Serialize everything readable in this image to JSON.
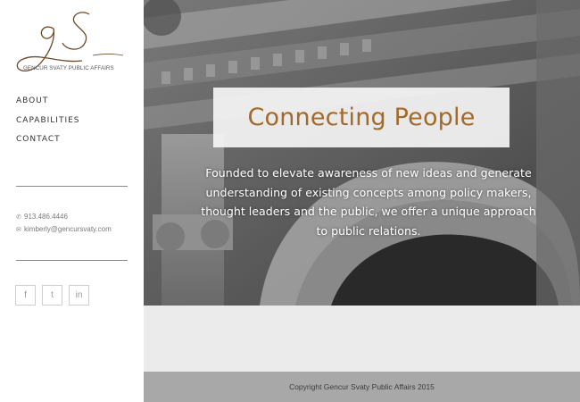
{
  "logo": {
    "monogram": "gS",
    "text": "GENCUR SVATY PUBLIC AFFAIRS",
    "icon": "gs-monogram-logo"
  },
  "nav": {
    "items": [
      {
        "label": "ABOUT"
      },
      {
        "label": "CAPABILITIES"
      },
      {
        "label": "CONTACT"
      }
    ]
  },
  "contact": {
    "phone": "913.486.4446",
    "phone_icon": "phone-icon",
    "email": "kimberly@gencursvaty.com",
    "email_icon": "envelope-icon"
  },
  "social": [
    {
      "glyph": "f",
      "icon": "facebook-icon"
    },
    {
      "glyph": "t",
      "icon": "twitter-icon"
    },
    {
      "glyph": "in",
      "icon": "linkedin-icon"
    }
  ],
  "hero": {
    "title": "Connecting People",
    "text": "Founded to elevate awareness of new ideas and generate understanding of existing concepts among policy makers, thought leaders and the public, we offer a unique approach to public relations."
  },
  "footer": {
    "copyright": "Copyright Gencur Svaty Public Affairs 2015"
  },
  "colors": {
    "accent": "#a26a2a",
    "footer_bg": "#a8a8a8",
    "band_bg": "#ebebeb"
  }
}
